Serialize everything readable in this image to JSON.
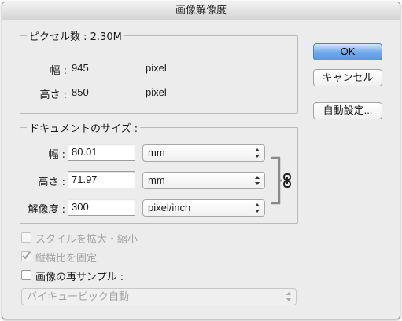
{
  "window": {
    "title": "画像解像度"
  },
  "pixel_dimensions": {
    "legend": "ピクセル数 : 2.30M",
    "width": {
      "label": "幅 :",
      "value": "945",
      "unit": "pixel"
    },
    "height": {
      "label": "高さ :",
      "value": "850",
      "unit": "pixel"
    }
  },
  "document_size": {
    "legend": "ドキュメントのサイズ :",
    "width": {
      "label": "幅 :",
      "value": "80.01",
      "unit": "mm"
    },
    "height": {
      "label": "高さ :",
      "value": "71.97",
      "unit": "mm"
    },
    "resolution": {
      "label": "解像度 :",
      "value": "300",
      "unit": "pixel/inch"
    }
  },
  "buttons": {
    "ok": "OK",
    "cancel": "キャンセル",
    "auto": "自動設定..."
  },
  "options": {
    "scale_styles": {
      "label": "スタイルを拡大・縮小",
      "checked": false,
      "enabled": false
    },
    "constrain_proportions": {
      "label": "縦横比を固定",
      "checked": true,
      "enabled": false
    },
    "resample": {
      "label": "画像の再サンプル :",
      "checked": false,
      "enabled": true
    }
  },
  "resample_method": {
    "value": "バイキュービック自動",
    "enabled": false
  },
  "icons": {
    "link": "chain-link-icon",
    "arrows": "updown-arrows-icon"
  },
  "colors": {
    "default_button": "#5b98e3"
  }
}
